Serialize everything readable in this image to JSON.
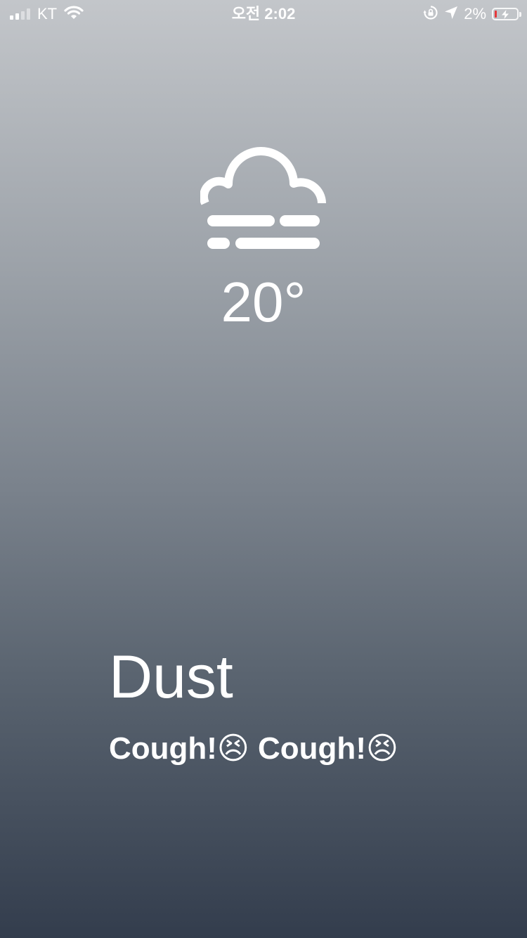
{
  "status_bar": {
    "carrier": "KT",
    "time": "오전 2:02",
    "battery_percent": "2%",
    "battery_level": 0.02,
    "signal_icon": "cellular-signal-icon",
    "wifi_icon": "wifi-icon",
    "orientation_lock_icon": "orientation-lock-icon",
    "location_icon": "location-arrow-icon",
    "battery_icon": "battery-charging-icon",
    "battery_low_color": "#e5383b"
  },
  "weather": {
    "icon": "fog-cloud-icon",
    "temperature": "20°",
    "condition": "Dust",
    "message": "Cough!😣 Cough!😣"
  },
  "colors": {
    "gradient_top": "#c3c6ca",
    "gradient_bottom": "#333d4d",
    "text": "#ffffff"
  }
}
